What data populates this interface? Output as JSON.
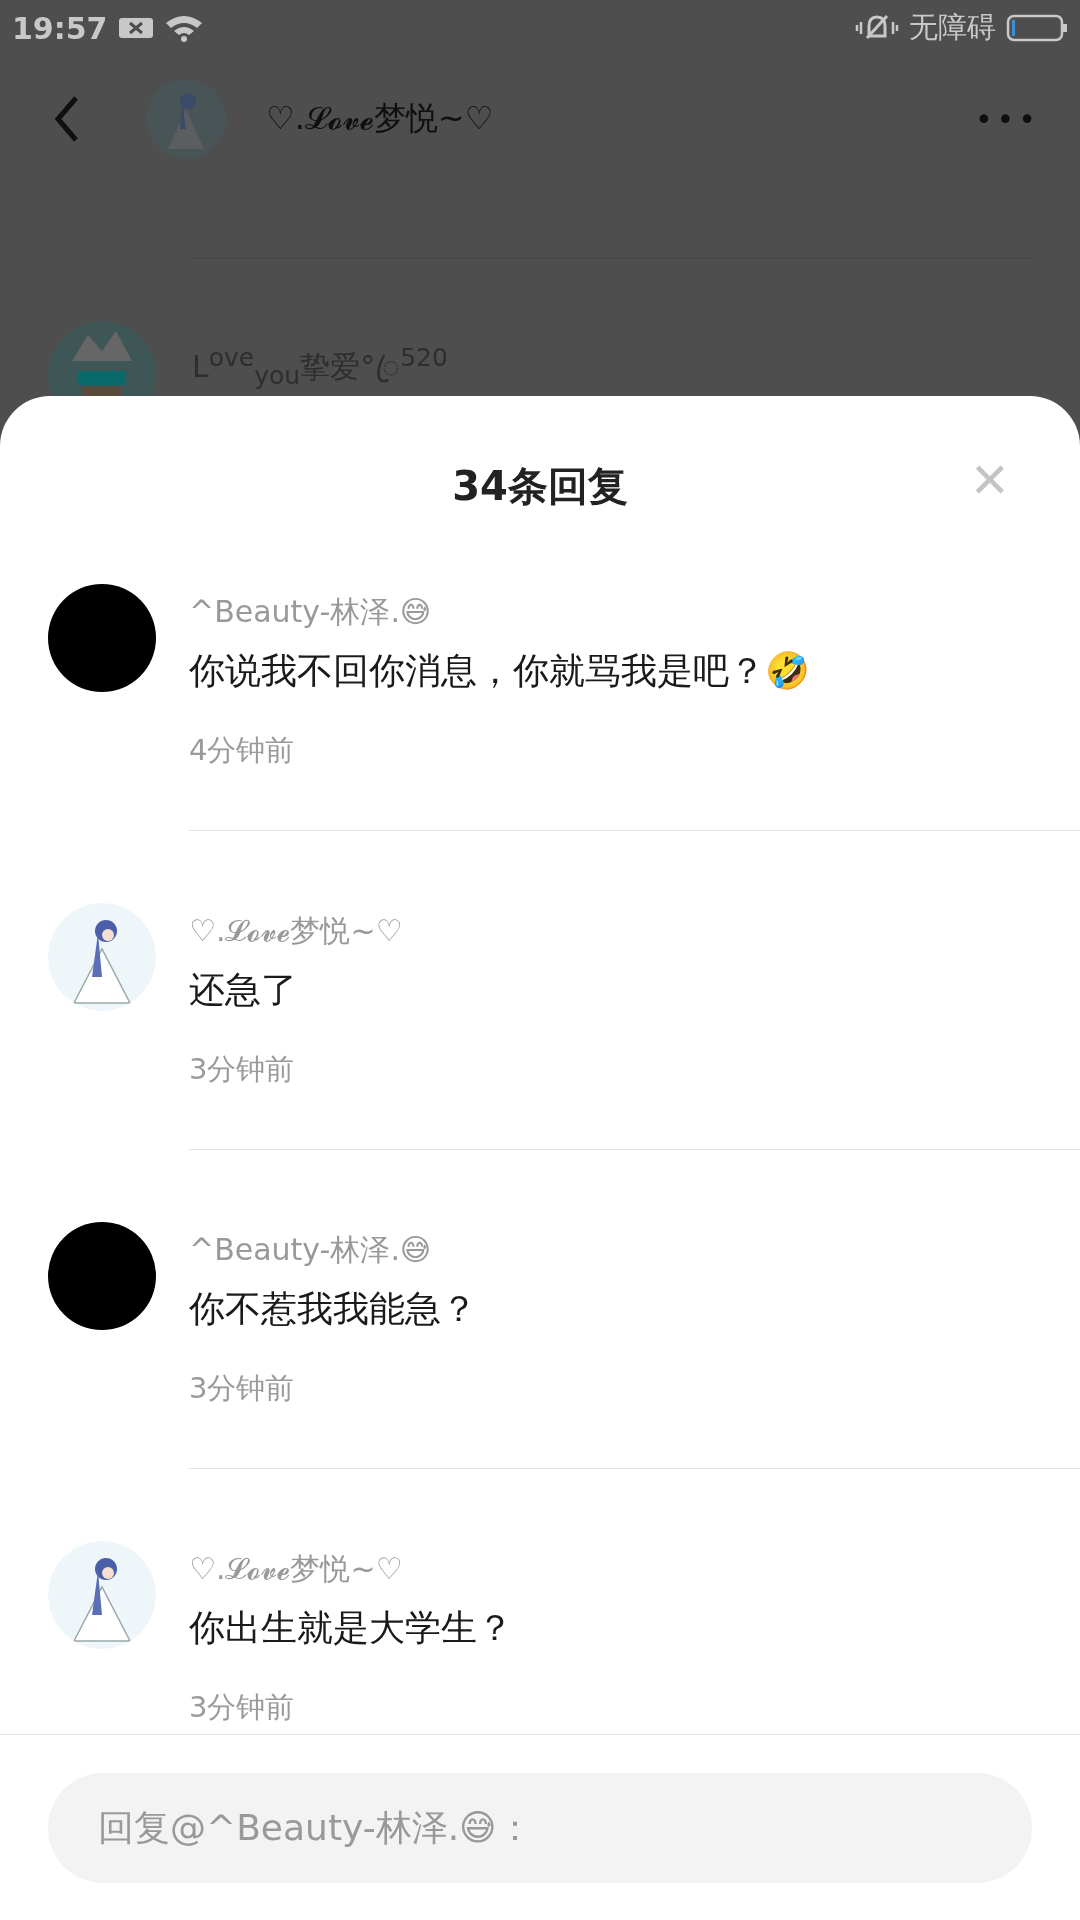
{
  "status_bar": {
    "time": "19:57",
    "accessibility": "无障碍"
  },
  "background_page": {
    "title": "♡.𝓛𝓸𝓿𝓮梦悦~♡",
    "more": "•••",
    "comment_preview": "L$^{ove}$$_{you}$挚爱°ꦿ$^{520}$"
  },
  "sheet": {
    "title": "34条回复",
    "close": "✕"
  },
  "replies": [
    {
      "avatar": {
        "kind": "blank"
      },
      "user": "^Beauty-林泽.😅",
      "text": "你说我不回你消息，你就骂我是吧？🤣",
      "time": "4分钟前"
    },
    {
      "user": "♡.𝓛𝓸𝓿𝓮梦悦~♡",
      "text": "还急了",
      "time": "3分钟前"
    },
    {
      "avatar": {
        "kind": "blank"
      },
      "user": "^Beauty-林泽.😅",
      "text": "你不惹我我能急？",
      "time": "3分钟前"
    },
    {
      "user": "♡.𝓛𝓸𝓿𝓮梦悦~♡",
      "text": "你出生就是大学生？",
      "time": "3分钟前"
    }
  ],
  "reply_input": {
    "placeholder": "回复@^Beauty-林泽.😅："
  }
}
